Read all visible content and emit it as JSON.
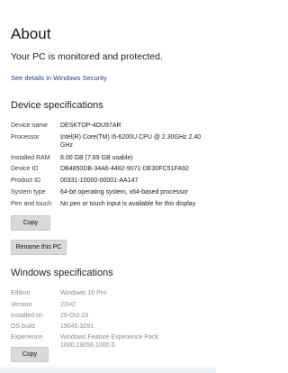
{
  "about": {
    "title": "About",
    "status": "Your PC is monitored and protected.",
    "security_link": "See details in Windows Security"
  },
  "device_specs": {
    "title": "Device specifications",
    "rows": [
      {
        "label": "Device name",
        "value": "DESKTOP-4OU97AR"
      },
      {
        "label": "Processor",
        "value": "Intel(R) Core(TM) i5-6200U CPU @ 2.30GHz   2.40 GHz"
      },
      {
        "label": "Installed RAM",
        "value": "8.00 GB (7.89 GB usable)"
      },
      {
        "label": "Device ID",
        "value": "DB4850DB-34A6-4482-9071-DE30FC51FA92"
      },
      {
        "label": "Product ID",
        "value": "00331-10000-00001-AA147"
      },
      {
        "label": "System type",
        "value": "64-bit operating system, x64-based processor"
      },
      {
        "label": "Pen and touch",
        "value": "No pen or touch input is available for this display"
      }
    ],
    "copy_label": "Copy",
    "rename_label": "Rename this PC"
  },
  "windows_specs": {
    "title": "Windows specifications",
    "rows": [
      {
        "label": "Edition",
        "value": "Windows 10 Pro"
      },
      {
        "label": "Version",
        "value": "22H2"
      },
      {
        "label": "Installed on",
        "value": "29-Oct-23"
      },
      {
        "label": "OS build",
        "value": "19045.3291"
      },
      {
        "label": "Experience",
        "value": "Windows Feature Experience Pack 1000.19056.1000.0"
      }
    ],
    "copy_label": "Copy"
  }
}
